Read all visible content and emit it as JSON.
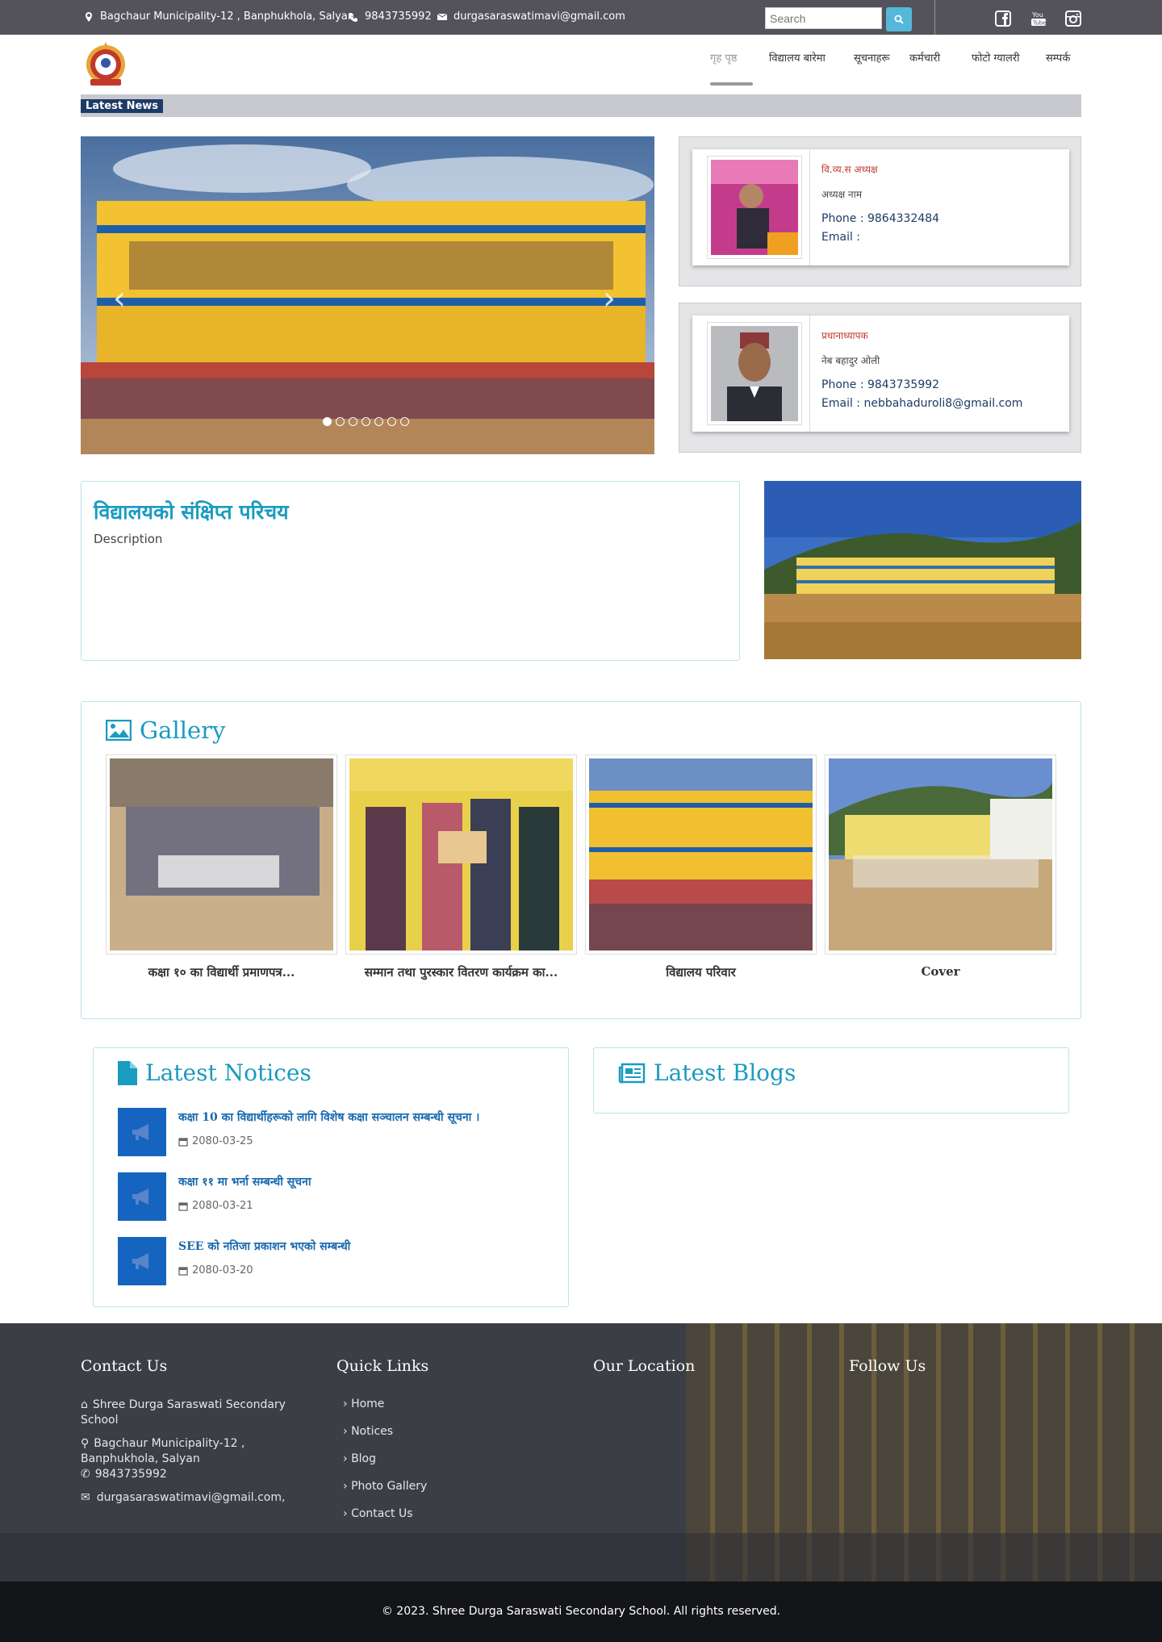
{
  "topbar": {
    "address": "Bagchaur Municipality-12 , Banphukhola, Salyan",
    "phone": "9843735992",
    "email": "durgasaraswatimavi@gmail.com",
    "search_placeholder": "Search",
    "social": [
      "facebook-icon",
      "youtube-icon",
      "instagram-icon"
    ]
  },
  "nav": {
    "items": [
      "गृह पृष्ठ",
      "विद्यालय बारेमा",
      "सूचनाहरू",
      "कर्मचारी",
      "फोटो ग्यालरी",
      "सम्पर्क"
    ],
    "active_index": 0
  },
  "news": {
    "label": "Latest News"
  },
  "carousel": {
    "prev": "‹",
    "next": "›",
    "slide_count": 7,
    "active_slide": 0
  },
  "persons": [
    {
      "name": "वि.व्य.स अध्यक्ष",
      "role": "अध्यक्ष नाम",
      "phone": "Phone : 9864332484",
      "email": "Email :"
    },
    {
      "name": "प्रधानाध्यापक",
      "role": "नेब बहादुर ओली",
      "phone": "Phone : 9843735992",
      "email": "Email : nebbahaduroli8@gmail.com"
    }
  ],
  "about": {
    "title": "विद्यालयको संक्षिप्त परिचय",
    "description": "Description"
  },
  "gallery": {
    "title": "Gallery",
    "items": [
      {
        "caption": "कक्षा १० का विद्यार्थी प्रमाणपत्र..."
      },
      {
        "caption": "सम्मान तथा पुरस्कार वितरण कार्यक्रम का..."
      },
      {
        "caption": "विद्यालय परिवार"
      },
      {
        "caption": "Cover"
      }
    ]
  },
  "notices": {
    "title": "Latest Notices",
    "items": [
      {
        "title": "कक्षा 10 का विद्यार्थीहरूको लागि विशेष कक्षा सञ्चालन सम्बन्धी सूचना ।",
        "date": "2080-03-25"
      },
      {
        "title": "कक्षा ११ मा भर्ना सम्बन्धी सूचना",
        "date": "2080-03-21"
      },
      {
        "title": "SEE को नतिजा प्रकाशन भएको सम्बन्धी",
        "date": "2080-03-20"
      }
    ]
  },
  "blogs": {
    "title": "Latest Blogs"
  },
  "footer": {
    "contact_title": "Contact Us",
    "school_name": "Shree Durga Saraswati Secondary School",
    "address": "Bagchaur Municipality-12 , Banphukhola, Salyan",
    "phone": "9843735992",
    "email": "durgasaraswatimavi@gmail.com,",
    "links_title": "Quick Links",
    "links": [
      "Home",
      "Notices",
      "Blog",
      "Photo Gallery",
      "Contact Us"
    ],
    "location_title": "Our Location",
    "follow_title": "Follow Us",
    "copyright": "© 2023. Shree Durga Saraswati Secondary School. All rights reserved."
  },
  "colors": {
    "accent": "#1a9bc0",
    "topbar": "#54535b",
    "navy": "#1e3a66",
    "notice_icon": "#1565c0"
  }
}
